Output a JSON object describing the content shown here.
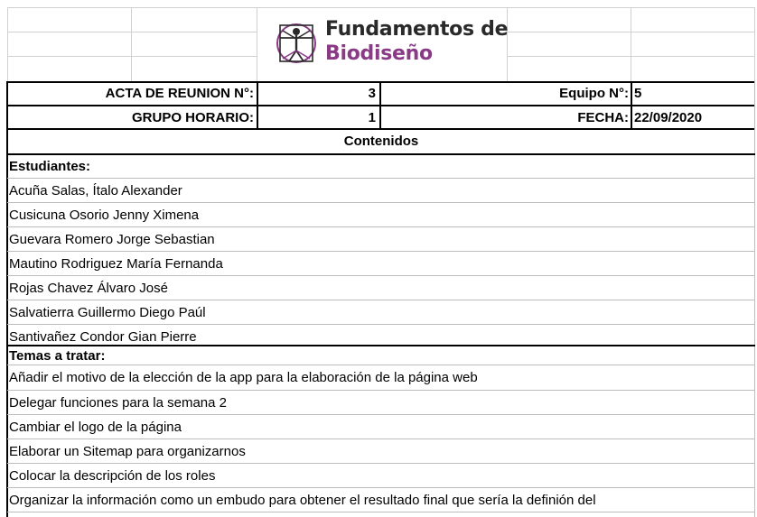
{
  "header": {
    "logo_title": "Fundamentos de",
    "logo_subtitle": "Biodiseño"
  },
  "meta": {
    "acta_label": "ACTA DE REUNION N°:",
    "acta_value": "3",
    "equipo_label": "Equipo N°:",
    "equipo_value": "5",
    "grupo_label": "GRUPO HORARIO:",
    "grupo_value": "1",
    "fecha_label": "FECHA:",
    "fecha_value": "22/09/2020"
  },
  "contents_title": "Contenidos",
  "students": {
    "heading": "Estudiantes:",
    "items": [
      "Acuña Salas, Ítalo Alexander",
      "Cusicuna Osorio Jenny Ximena",
      "Guevara Romero Jorge Sebastian",
      "Mautino Rodriguez María Fernanda",
      "Rojas Chavez Álvaro José",
      "Salvatierra Guillermo Diego Paúl",
      "Santivañez Condor Gian Pierre"
    ]
  },
  "topics": {
    "heading": "Temas a tratar:",
    "items": [
      "Añadir el motivo de la elección de la app para la elaboración de la página web",
      "Delegar funciones para la semana 2",
      "Cambiar el logo de la página",
      "Elaborar un Sitemap para organizarnos",
      "Colocar la descripción de los roles",
      "Organizar la información como un embudo para obtener el resultado final que sería la definión del"
    ]
  },
  "colors": {
    "logo_title": "#2a2a2a",
    "logo_subtitle": "#8a3a86"
  }
}
